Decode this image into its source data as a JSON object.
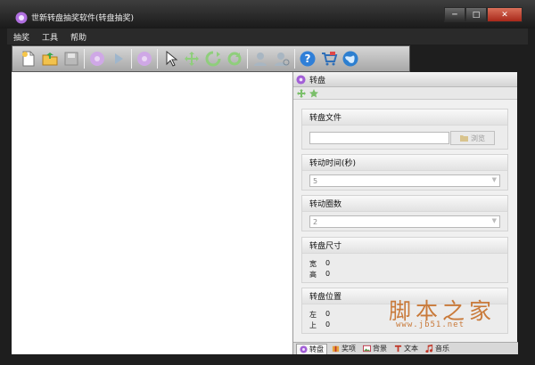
{
  "window": {
    "title": "世新转盘抽奖软件(转盘抽奖)",
    "controls": {
      "minimize": "─",
      "maximize": "□",
      "close": "✕"
    }
  },
  "menu": {
    "items": [
      "抽奖",
      "工具",
      "帮助"
    ]
  },
  "toolbar": {
    "icons": [
      "new-file-icon",
      "open-folder-icon",
      "save-icon",
      "wheel-icon",
      "play-icon",
      "wheel-settings-icon",
      "pointer-icon",
      "move-icon",
      "rotate-icon",
      "refresh-icon",
      "user-icon",
      "user-search-icon",
      "help-icon",
      "cart-icon",
      "globe-icon"
    ]
  },
  "panel": {
    "title": "转盘",
    "groups": {
      "file": {
        "title": "转盘文件",
        "value": "",
        "browse_label": "浏览"
      },
      "duration": {
        "title": "转动时间(秒)",
        "value": "5"
      },
      "rounds": {
        "title": "转动圈数",
        "value": "2"
      },
      "size": {
        "title": "转盘尺寸",
        "width_label": "宽",
        "width_value": "0",
        "height_label": "高",
        "height_value": "0"
      },
      "position": {
        "title": "转盘位置",
        "left_label": "左",
        "left_value": "0",
        "top_label": "上",
        "top_value": "0"
      }
    },
    "tabs": [
      {
        "label": "转盘",
        "icon": "wheel-icon",
        "active": true
      },
      {
        "label": "奖项",
        "icon": "prize-icon",
        "active": false
      },
      {
        "label": "背景",
        "icon": "image-icon",
        "active": false
      },
      {
        "label": "文本",
        "icon": "text-icon",
        "active": false
      },
      {
        "label": "音乐",
        "icon": "music-icon",
        "active": false
      }
    ]
  },
  "watermark": {
    "text": "脚本之家",
    "url": "www.jb51.net"
  },
  "colors": {
    "titlebar": "#2a2a2a",
    "panel": "#f0f0f0",
    "accent": "#a25fd6",
    "watermark": "#c97a3a"
  }
}
